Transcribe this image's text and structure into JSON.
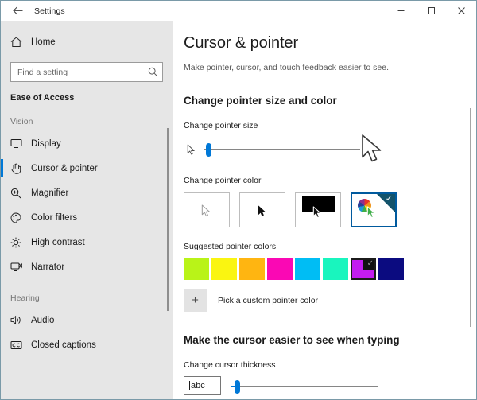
{
  "titlebar": {
    "back_icon": "back-arrow-icon",
    "title": "Settings",
    "minimize": "–",
    "maximize": "☐",
    "close": "✕"
  },
  "sidebar": {
    "home": {
      "label": "Home",
      "icon": "home-icon"
    },
    "search": {
      "placeholder": "Find a setting",
      "value": "",
      "icon": "search-icon"
    },
    "section_header": "Ease of Access",
    "groups": [
      {
        "label": "Vision",
        "items": [
          {
            "label": "Display",
            "icon": "monitor-icon",
            "selected": false
          },
          {
            "label": "Cursor & pointer",
            "icon": "pointer-hand-icon",
            "selected": true
          },
          {
            "label": "Magnifier",
            "icon": "magnifier-icon",
            "selected": false
          },
          {
            "label": "Color filters",
            "icon": "palette-icon",
            "selected": false
          },
          {
            "label": "High contrast",
            "icon": "sun-icon",
            "selected": false
          },
          {
            "label": "Narrator",
            "icon": "narrator-icon",
            "selected": false
          }
        ]
      },
      {
        "label": "Hearing",
        "items": [
          {
            "label": "Audio",
            "icon": "speaker-icon",
            "selected": false
          },
          {
            "label": "Closed captions",
            "icon": "closed-captions-icon",
            "selected": false
          }
        ]
      }
    ]
  },
  "main": {
    "page_title": "Cursor & pointer",
    "page_subtitle": "Make pointer, cursor, and touch feedback easier to see.",
    "section_pointer": {
      "title": "Change pointer size and color",
      "size_label": "Change pointer size",
      "size_value": 1,
      "size_min": 1,
      "size_max": 15,
      "color_label": "Change pointer color",
      "color_tiles": [
        {
          "name": "white-pointer",
          "selected": false
        },
        {
          "name": "black-pointer",
          "selected": false
        },
        {
          "name": "inverted-pointer",
          "selected": false
        },
        {
          "name": "custom-color-pointer",
          "selected": true
        }
      ],
      "suggested_label": "Suggested pointer colors",
      "suggested_colors": [
        {
          "hex": "#B9F318",
          "selected": false
        },
        {
          "hex": "#FAF511",
          "selected": false
        },
        {
          "hex": "#FFB511",
          "selected": false
        },
        {
          "hex": "#FA08B4",
          "selected": false
        },
        {
          "hex": "#00BDF4",
          "selected": false
        },
        {
          "hex": "#19F5BE",
          "selected": false
        },
        {
          "hex": "#C31CF0",
          "selected": true
        },
        {
          "hex": "#0B0B80",
          "selected": false
        }
      ],
      "custom_button": {
        "label": "Pick a custom pointer color",
        "icon": "plus-icon"
      }
    },
    "section_cursor": {
      "title": "Make the cursor easier to see when typing",
      "thickness_label": "Change cursor thickness",
      "preview_text": "abc",
      "thickness_value": 1,
      "thickness_min": 1,
      "thickness_max": 20
    }
  },
  "colors": {
    "accent": "#0078d7",
    "sidebar_bg": "#e6e6e6",
    "selected_tile_border": "#005a9e",
    "corner_badge": "#13536b"
  }
}
